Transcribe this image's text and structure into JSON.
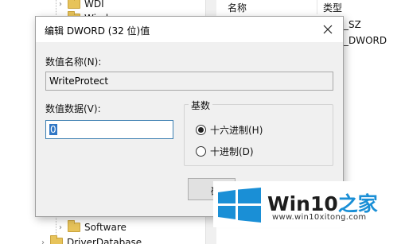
{
  "tree": {
    "items": [
      {
        "label": "WDI"
      },
      {
        "label": "Wind"
      },
      {
        "label": "Software"
      },
      {
        "label": "DriverDatabase"
      }
    ]
  },
  "list": {
    "headers": [
      "名称",
      "类型"
    ],
    "type_values": [
      "_SZ",
      "_DWORD"
    ]
  },
  "dialog": {
    "title": "编辑 DWORD (32 位)值",
    "value_name_label": "数值名称(N):",
    "value_name": "WriteProtect",
    "value_data_label": "数值数据(V):",
    "value_data": "0",
    "base_label": "基数",
    "radix_hex_label": "十六进制(H)",
    "radix_dec_label": "十进制(D)",
    "radix_selected": "hex",
    "ok_button_partial": "确"
  },
  "watermark": {
    "brand": "Win10",
    "brand_zh": "之家",
    "url": "www.win10xitong.com",
    "color": "#1a8fd6"
  }
}
